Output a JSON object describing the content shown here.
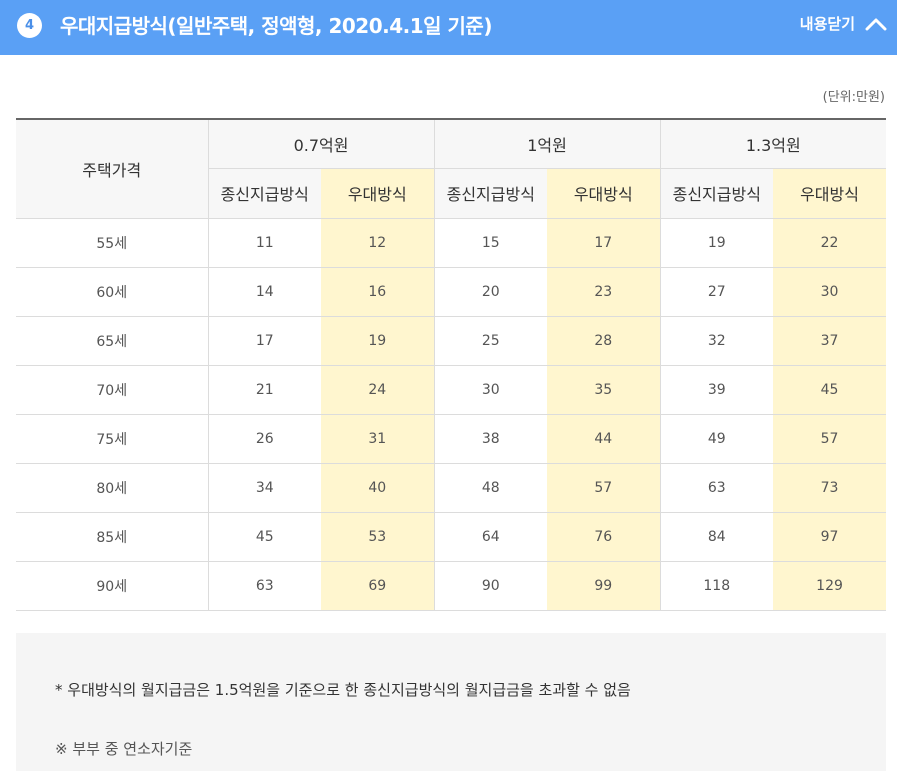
{
  "header": {
    "step_number": "4",
    "title": "우대지급방식(일반주택, 정액형, 2020.4.1일 기준)",
    "toggle_label": "내용닫기"
  },
  "unit_label": "(단위:만원)",
  "table": {
    "row_header": "주택가격",
    "price_groups": [
      "0.7억원",
      "1억원",
      "1.3억원"
    ],
    "sub_headers": [
      "종신지급방식",
      "우대방식",
      "종신지급방식",
      "우대방식",
      "종신지급방식",
      "우대방식"
    ],
    "rows": [
      {
        "age": "55세",
        "values": [
          "11",
          "12",
          "15",
          "17",
          "19",
          "22"
        ]
      },
      {
        "age": "60세",
        "values": [
          "14",
          "16",
          "20",
          "23",
          "27",
          "30"
        ]
      },
      {
        "age": "65세",
        "values": [
          "17",
          "19",
          "25",
          "28",
          "32",
          "37"
        ]
      },
      {
        "age": "70세",
        "values": [
          "21",
          "24",
          "30",
          "35",
          "39",
          "45"
        ]
      },
      {
        "age": "75세",
        "values": [
          "26",
          "31",
          "38",
          "44",
          "49",
          "57"
        ]
      },
      {
        "age": "80세",
        "values": [
          "34",
          "40",
          "48",
          "57",
          "63",
          "73"
        ]
      },
      {
        "age": "85세",
        "values": [
          "45",
          "53",
          "64",
          "76",
          "84",
          "97"
        ]
      },
      {
        "age": "90세",
        "values": [
          "63",
          "69",
          "90",
          "99",
          "118",
          "129"
        ]
      }
    ]
  },
  "notes": {
    "note1": "* 우대방식의 월지급금은 1.5억원을 기준으로 한 종신지급방식의 월지급금을 초과할 수 없음",
    "note2": "※ 부부 중 연소자기준"
  },
  "colors": {
    "header_bg": "#5aa0f5",
    "highlight_bg": "#fff6cf",
    "note_bg": "#f5f5f5"
  },
  "icons": {
    "toggle": "chevron-up-icon"
  }
}
